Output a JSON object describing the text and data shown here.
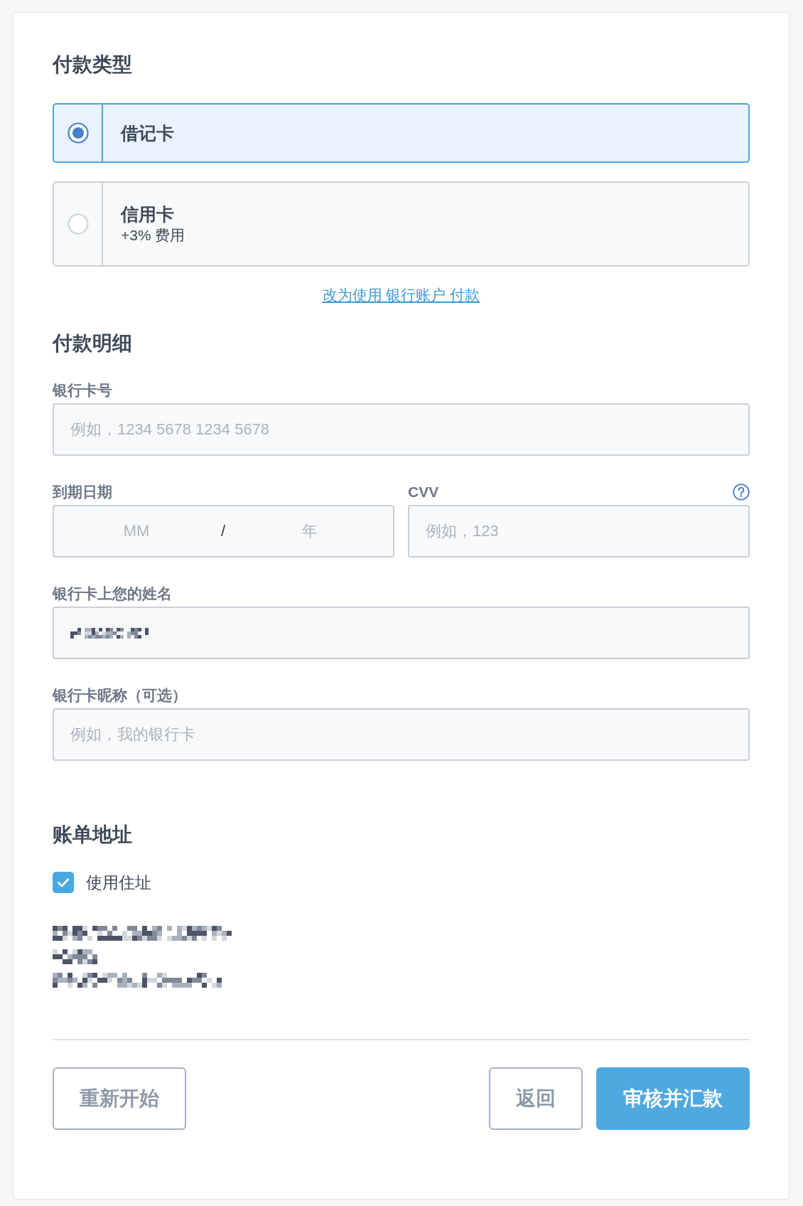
{
  "payment_type": {
    "title": "付款类型",
    "options": [
      {
        "label": "借记卡",
        "selected": true
      },
      {
        "label": "信用卡",
        "note": "+3% 费用",
        "selected": false
      }
    ],
    "switch_link": "改为使用 银行账户 付款"
  },
  "payment_details": {
    "title": "付款明细",
    "card_number": {
      "label": "银行卡号",
      "placeholder": "例如，1234 5678 1234 5678"
    },
    "expiry": {
      "label": "到期日期",
      "month_placeholder": "MM",
      "separator": "/",
      "year_placeholder": "年"
    },
    "cvv": {
      "label": "CVV",
      "placeholder": "例如，123",
      "help": true
    },
    "cardholder_name": {
      "label": "银行卡上您的姓名",
      "value_redacted": true
    },
    "nickname": {
      "label": "银行卡昵称（可选）",
      "placeholder": "例如，我的银行卡"
    }
  },
  "billing_address": {
    "title": "账单地址",
    "use_home_address": {
      "label": "使用住址",
      "checked": true
    },
    "address_lines": [
      {
        "redacted": true
      },
      {
        "redacted": true
      },
      {
        "redacted": true
      }
    ]
  },
  "footer": {
    "left_buttons": [
      {
        "label": "重新开始",
        "kind": "secondary"
      }
    ],
    "right_buttons": [
      {
        "label": "返回",
        "kind": "secondary"
      },
      {
        "label": "审核并汇款",
        "kind": "primary"
      }
    ]
  }
}
